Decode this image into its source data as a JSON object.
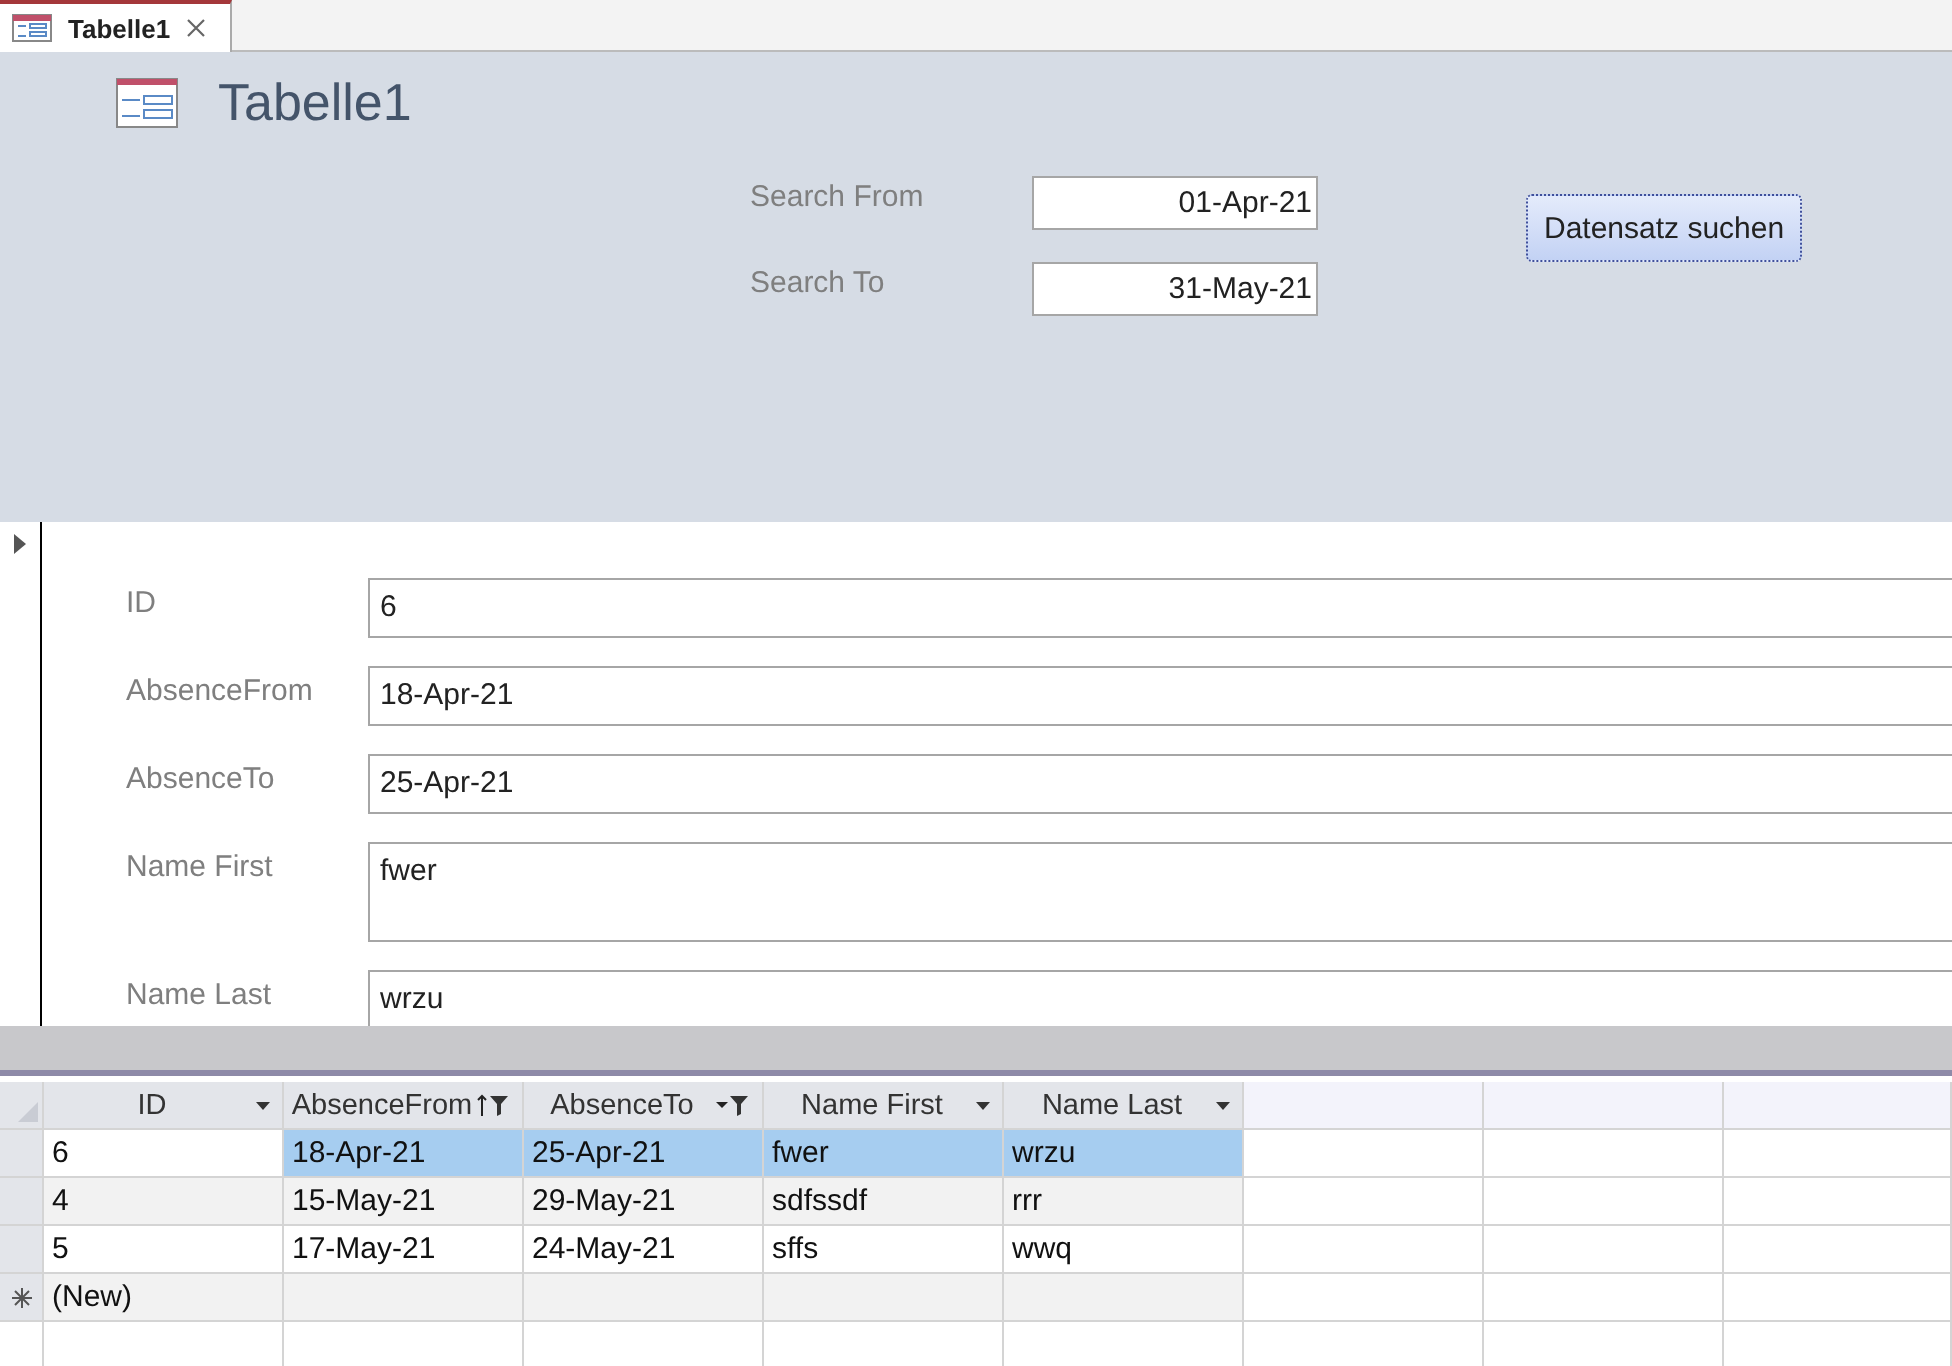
{
  "tabs": [
    {
      "label": "Tabelle1",
      "selected": true
    }
  ],
  "form": {
    "title": "Tabelle1",
    "search": [
      {
        "label": "Search From",
        "value": "01-Apr-21"
      },
      {
        "label": "Search To",
        "value": "31-May-21"
      }
    ],
    "button": "Datensatz suchen"
  },
  "detail": {
    "fields": [
      {
        "label": "ID",
        "value": "6",
        "kind": "single"
      },
      {
        "label": "AbsenceFrom",
        "value": "18-Apr-21",
        "kind": "single"
      },
      {
        "label": "AbsenceTo",
        "value": "25-Apr-21",
        "kind": "single"
      },
      {
        "label": "Name First",
        "value": "fwer",
        "kind": "multi"
      },
      {
        "label": "Name Last",
        "value": "wrzu",
        "kind": "single"
      }
    ]
  },
  "datasheet": {
    "columns": [
      {
        "label": "ID",
        "kind": "dropdown"
      },
      {
        "label": "AbsenceFrom",
        "kind": "sort_filter"
      },
      {
        "label": "AbsenceTo",
        "kind": "filter"
      },
      {
        "label": "Name First",
        "kind": "dropdown"
      },
      {
        "label": "Name Last",
        "kind": "dropdown"
      }
    ],
    "rows": [
      {
        "cells": [
          "6",
          "18-Apr-21",
          "25-Apr-21",
          "fwer",
          "wrzu"
        ],
        "selected": true
      },
      {
        "cells": [
          "4",
          "15-May-21",
          "29-May-21",
          "sdfssdf",
          "rrr"
        ],
        "selected": false
      },
      {
        "cells": [
          "5",
          "17-May-21",
          "24-May-21",
          "sffs",
          "wwq"
        ],
        "selected": false
      }
    ],
    "new_row": "(New)"
  }
}
